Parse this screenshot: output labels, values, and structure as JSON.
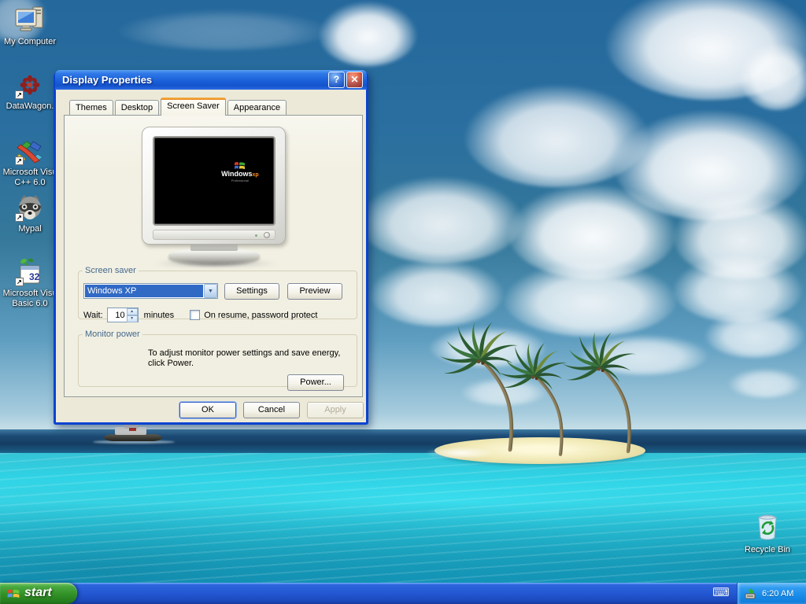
{
  "dialog": {
    "title": "Display Properties",
    "help_button": "?",
    "close_button": "✕",
    "tabs": [
      {
        "label": "Themes"
      },
      {
        "label": "Desktop"
      },
      {
        "label": "Screen Saver"
      },
      {
        "label": "Appearance"
      }
    ],
    "monitor_preview": {
      "logo_windows": "Windows",
      "logo_xp": "xp",
      "logo_sub": "Professional"
    },
    "screen_saver_group": {
      "legend": "Screen saver",
      "selected_saver": "Windows XP",
      "settings_label": "Settings",
      "preview_label": "Preview",
      "wait_label": "Wait:",
      "wait_value": "10",
      "minutes_label": "minutes",
      "resume_label": "On resume, password protect",
      "checkbox_checked": false
    },
    "monitor_power_group": {
      "legend": "Monitor power",
      "text_line1": "To adjust monitor power settings and save energy,",
      "text_line2": "click Power.",
      "power_label": "Power..."
    },
    "buttons": {
      "ok": "OK",
      "cancel": "Cancel",
      "apply": "Apply"
    }
  },
  "desktop_icons": [
    {
      "label": "My Computer"
    },
    {
      "label": "DataWagon."
    },
    {
      "label": "Microsoft Visu",
      "label2": "C++ 6.0"
    },
    {
      "label": "Mypal"
    },
    {
      "label": "Microsoft Visu",
      "label2": "Basic 6.0"
    },
    {
      "label": "Recycle Bin"
    }
  ],
  "taskbar": {
    "start_label": "start",
    "clock": "6:20 AM"
  },
  "icons": {
    "combo_arrow": "▼",
    "spin_up": "▲",
    "spin_down": "▼",
    "keyboard": "⌨",
    "shortcut_arrow": "↗"
  },
  "colors": {
    "title_gradient_top": "#5ba0f2",
    "title_gradient_bottom": "#1453cc",
    "selection_blue": "#316ac5",
    "tab_accent_orange": "#e68b2c",
    "taskbar_blue": "#2458d4",
    "start_green": "#319127",
    "tray_blue": "#178ce9",
    "water_turquoise": "#2fd2e4",
    "sand": "#efe7b2"
  }
}
